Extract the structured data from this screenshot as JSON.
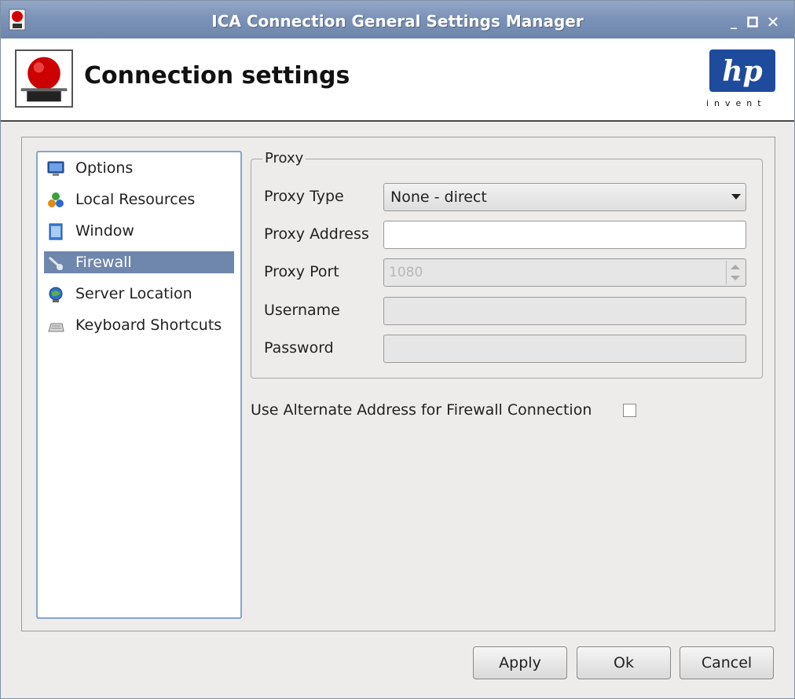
{
  "window": {
    "title": "ICA Connection General Settings Manager",
    "icon": "app-icon",
    "controls": [
      "minimize-icon",
      "maximize-icon",
      "close-icon"
    ]
  },
  "header": {
    "title": "Connection settings",
    "logo_text": "hp",
    "logo_tagline": "invent"
  },
  "sidebar": {
    "items": [
      {
        "label": "Options",
        "icon": "monitor-icon"
      },
      {
        "label": "Local Resources",
        "icon": "resources-icon"
      },
      {
        "label": "Window",
        "icon": "window-icon"
      },
      {
        "label": "Firewall",
        "icon": "firewall-icon",
        "selected": true
      },
      {
        "label": "Server Location",
        "icon": "globe-icon"
      },
      {
        "label": "Keyboard Shortcuts",
        "icon": "keyboard-icon"
      }
    ]
  },
  "proxy": {
    "group_label": "Proxy",
    "type_label": "Proxy Type",
    "type_value": "None - direct",
    "address_label": "Proxy Address",
    "address_value": "",
    "port_label": "Proxy Port",
    "port_value": "1080",
    "username_label": "Username",
    "username_value": "",
    "password_label": "Password",
    "password_value": ""
  },
  "alternate_address": {
    "label": "Use Alternate Address for Firewall Connection",
    "checked": false
  },
  "buttons": {
    "apply": "Apply",
    "ok": "Ok",
    "cancel": "Cancel"
  },
  "colors": {
    "titlebar": "#7c93b8",
    "selection": "#6f86ad",
    "hp_blue": "#1e4b9c"
  }
}
